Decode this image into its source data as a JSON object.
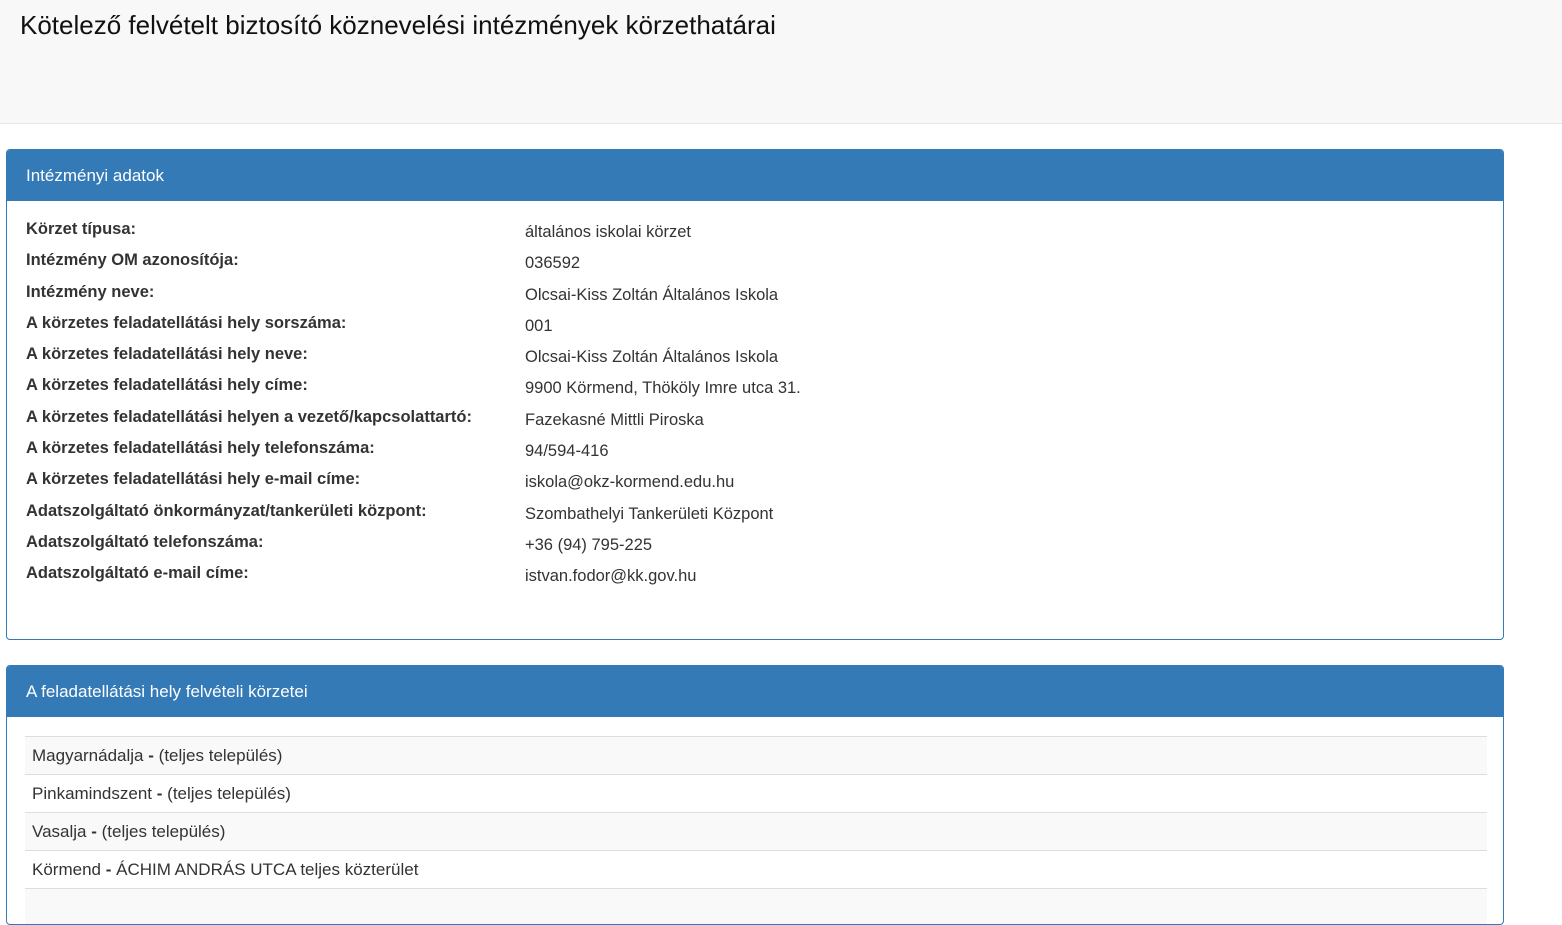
{
  "header": {
    "title": "Kötelező felvételt biztosító köznevelési intézmények körzethatárai"
  },
  "institution_panel": {
    "heading": "Intézményi adatok",
    "rows": [
      {
        "label": "Körzet típusa:",
        "value": "általános iskolai körzet"
      },
      {
        "label": "Intézmény OM azonosítója:",
        "value": "036592"
      },
      {
        "label": "Intézmény neve:",
        "value": "Olcsai-Kiss Zoltán Általános Iskola"
      },
      {
        "label": "A körzetes feladatellátási hely sorszáma:",
        "value": "001"
      },
      {
        "label": "A körzetes feladatellátási hely neve:",
        "value": "Olcsai-Kiss Zoltán Általános Iskola"
      },
      {
        "label": "A körzetes feladatellátási hely címe:",
        "value": "9900 Körmend, Thököly Imre utca 31."
      },
      {
        "label": "A körzetes feladatellátási helyen a vezető/kapcsolattartó:",
        "value": "Fazekasné Mittli Piroska"
      },
      {
        "label": "A körzetes feladatellátási hely telefonszáma:",
        "value": "94/594-416"
      },
      {
        "label": "A körzetes feladatellátási hely e-mail címe:",
        "value": "iskola@okz-kormend.edu.hu"
      },
      {
        "label": "Adatszolgáltató önkormányzat/tankerületi központ:",
        "value": "Szombathelyi Tankerületi Központ"
      },
      {
        "label": "Adatszolgáltató telefonszáma:",
        "value": "+36 (94) 795-225"
      },
      {
        "label": "Adatszolgáltató e-mail címe:",
        "value": "istvan.fodor@kk.gov.hu"
      }
    ]
  },
  "districts_panel": {
    "heading": "A feladatellátási hely felvételi körzetei",
    "separator": "-",
    "items": [
      {
        "place": "Magyarnádalja",
        "scope": "(teljes település)"
      },
      {
        "place": "Pinkamindszent",
        "scope": "(teljes település)"
      },
      {
        "place": "Vasalja",
        "scope": "(teljes település)"
      },
      {
        "place": "Körmend",
        "scope": "ÁCHIM ANDRÁS UTCA teljes közterület"
      },
      {
        "place": "",
        "scope": ""
      }
    ]
  }
}
